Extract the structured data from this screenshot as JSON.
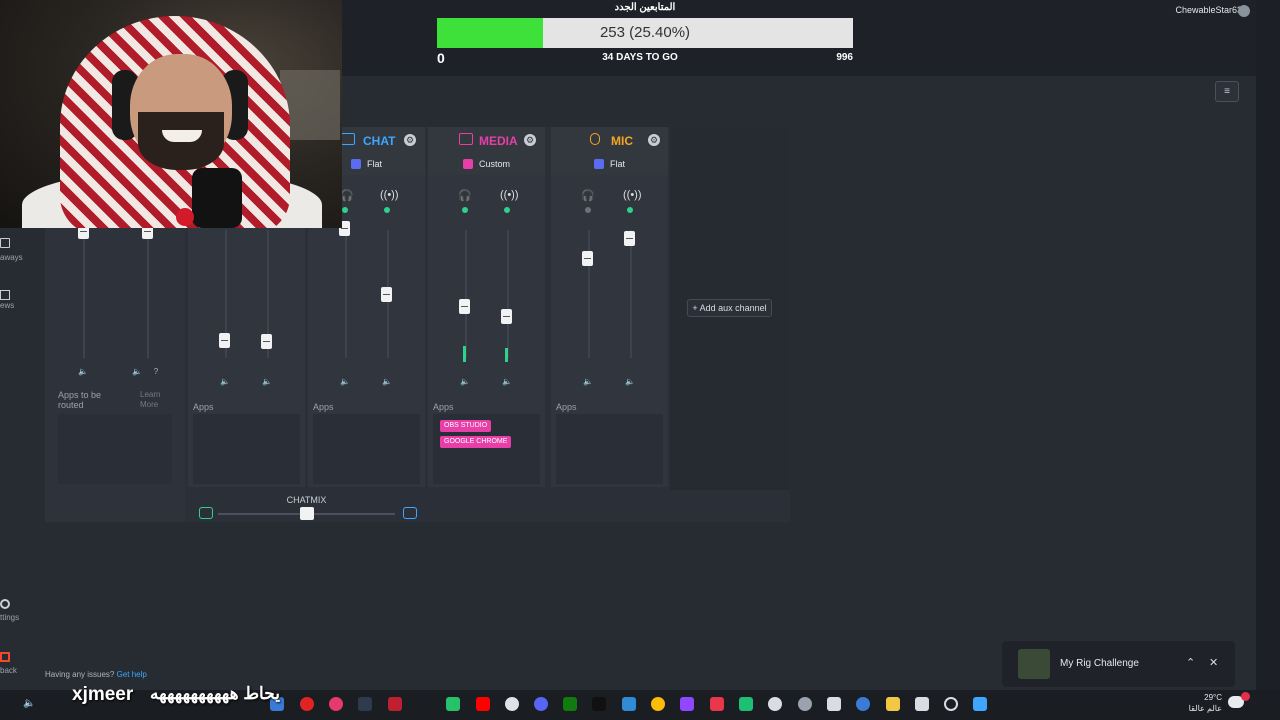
{
  "goal": {
    "title": "المتابعين الجدد",
    "progress_label": "253 (25.40%)",
    "progress_fraction": 0.254,
    "start": "0",
    "days_left": "34 DAYS TO GO",
    "end": "996",
    "fill_color": "#3ee03a"
  },
  "header": {
    "username": "ChewableStar63",
    "menu_icon": "hamburger-icon"
  },
  "sidebar": {
    "giveaways_fragment": "aways",
    "news_fragment": "ews",
    "settings_fragment": "ttings",
    "feedback_fragment": "back"
  },
  "channels": {
    "left_apps_label": "Apps to be routed",
    "learn_more": "Learn More",
    "game_apps_label": "Apps",
    "chat": {
      "name": "CHAT",
      "preset": "Flat",
      "color": "#3ea6ff",
      "apps_label": "Apps"
    },
    "media": {
      "name": "MEDIA",
      "preset": "Custom",
      "color": "#e83ea8",
      "apps_label": "Apps",
      "apps": [
        "OBS STUDIO",
        "GOOGLE CHROME"
      ],
      "levels": [
        0.45,
        0.4
      ]
    },
    "mic": {
      "name": "MIC",
      "preset": "Flat",
      "color": "#f5a623",
      "apps_label": "Apps"
    }
  },
  "aux": {
    "add_label": "+ Add aux channel"
  },
  "chatmix": {
    "label": "CHATMIX",
    "balance": 0.5
  },
  "help": {
    "text": "Having any issues?",
    "link": "Get help"
  },
  "toast": {
    "title": "My Rig Challenge"
  },
  "stream_overlay": {
    "name": "xjmeer",
    "message": "يحاط ههههههههههه"
  },
  "tray": {
    "temp": "29°C",
    "location": "عالم عالقا"
  },
  "colors": {
    "accent_green": "#2fd28c",
    "preset_icon": "#5b6cf0"
  }
}
